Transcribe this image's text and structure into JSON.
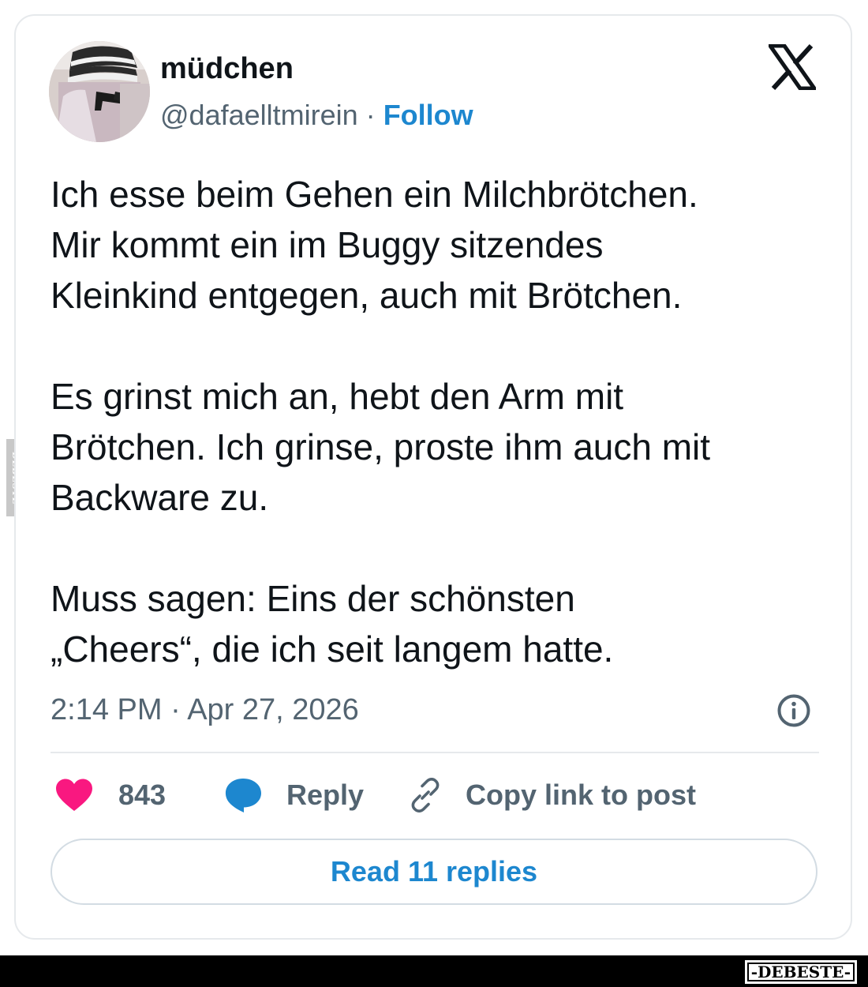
{
  "tweet": {
    "display_name": "müdchen",
    "handle": "@dafaelltmirein",
    "separator": "·",
    "follow_label": "Follow",
    "paragraphs": [
      "Ich esse beim Gehen ein Milchbrötchen.\nMir kommt ein im Buggy sitzendes\nKleinkind entgegen, auch mit Brötchen.",
      "Es grinst mich an, hebt den Arm mit\nBrötchen. Ich grinse, proste ihm auch mit\nBackware zu.",
      "Muss sagen: Eins der schönsten\n„Cheers“, die ich seit langem hatte."
    ],
    "timestamp": "2:14 PM · Apr 27, 2026"
  },
  "actions": {
    "like_count": "843",
    "reply_label": "Reply",
    "copy_label": "Copy link to post"
  },
  "read_replies_label": "Read 11 replies",
  "icons": {
    "brand": "x-logo-icon",
    "info": "info-icon",
    "like": "heart-icon",
    "reply": "speech-bubble-icon",
    "copy": "link-icon"
  },
  "colors": {
    "accent": "#1d87cf",
    "heart": "#f91880",
    "text": "#0f1419",
    "secondary": "#536471",
    "border": "#e6e9ec"
  },
  "watermarks": {
    "side": "DEBESTE",
    "footer": "-DEBESTE-"
  }
}
